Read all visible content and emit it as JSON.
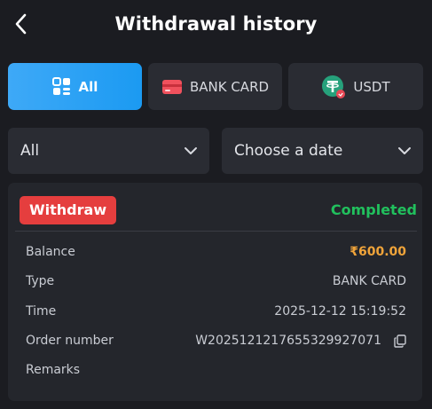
{
  "header": {
    "title": "Withdrawal history",
    "back_icon": "chevron-left-icon"
  },
  "tabs": [
    {
      "label": "All",
      "icon": "grid-icon",
      "active": true
    },
    {
      "label": "BANK CARD",
      "icon": "bank-card-icon",
      "active": false
    },
    {
      "label": "USDT",
      "icon": "tether-icon",
      "active": false
    }
  ],
  "filters": {
    "type": {
      "value": "All"
    },
    "date": {
      "value": "Choose a date"
    }
  },
  "record": {
    "badge": "Withdraw",
    "status": "Completed",
    "rows": [
      {
        "label": "Balance",
        "value": "₹600.00"
      },
      {
        "label": "Type",
        "value": "BANK CARD"
      },
      {
        "label": "Time",
        "value": "2025-12-12 15:19:52"
      },
      {
        "label": "Order number",
        "value": "W2025121217655329927071"
      },
      {
        "label": "Remarks",
        "value": ""
      }
    ]
  },
  "colors": {
    "background": "#1b1c21",
    "accent": "#1b9af2",
    "withdraw_badge": "#e53e3e",
    "completed": "#21c05d",
    "amount": "#f0a43a"
  }
}
